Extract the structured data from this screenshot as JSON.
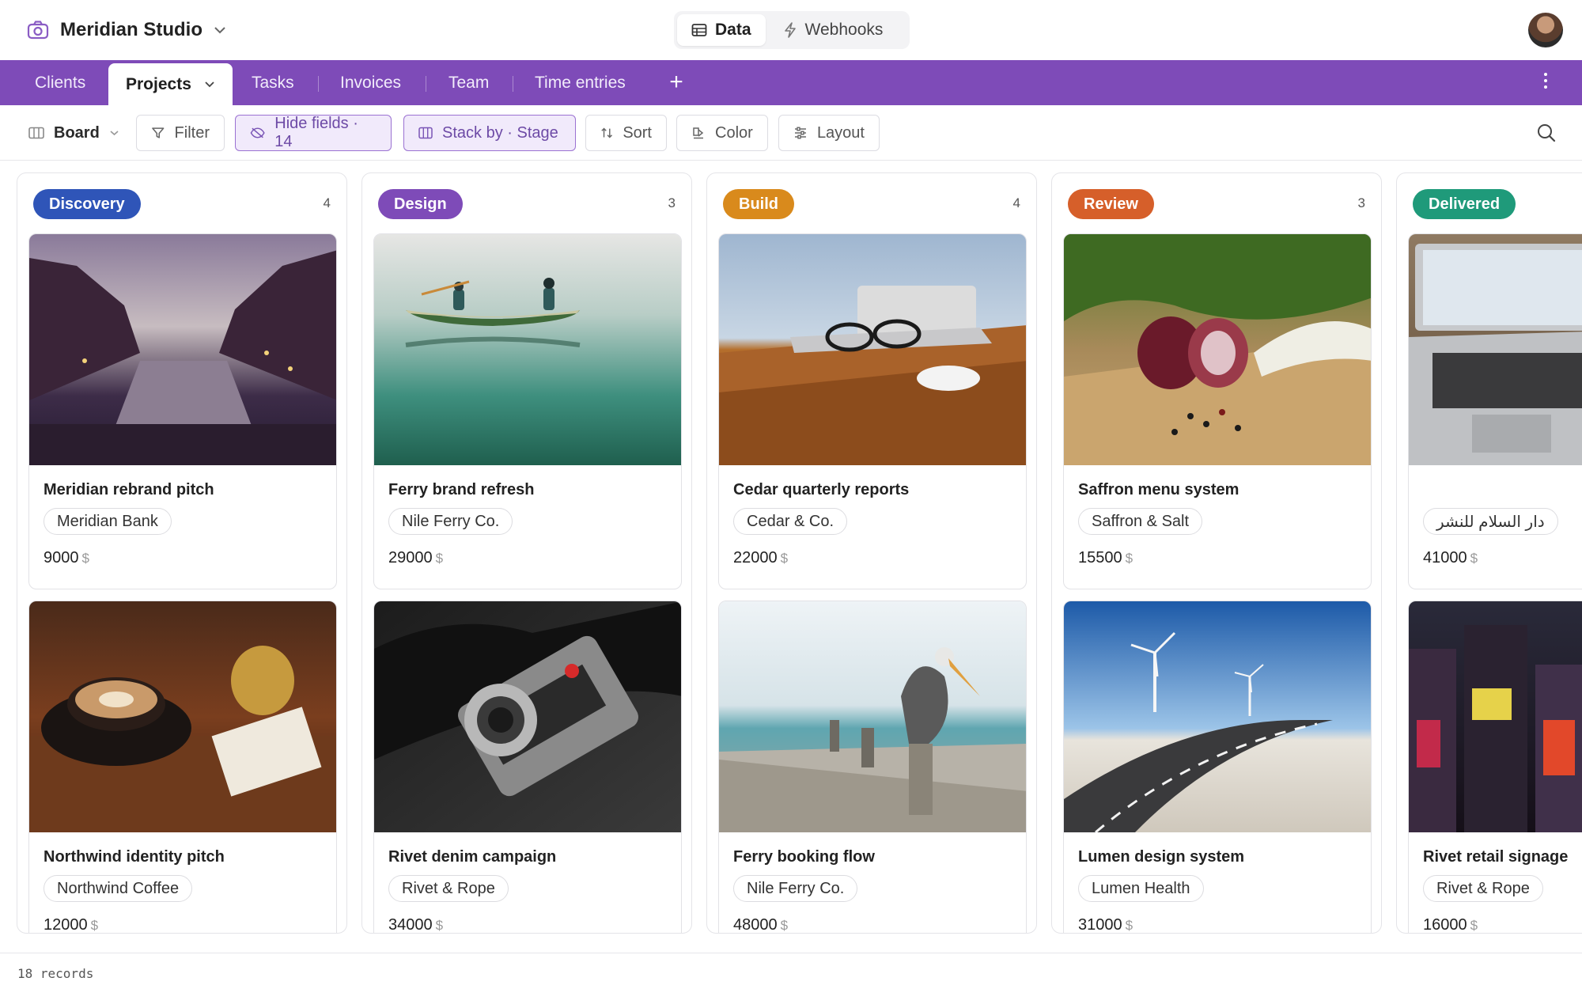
{
  "header": {
    "workspace": "Meridian Studio",
    "toggle": [
      {
        "label": "Data",
        "active": true
      },
      {
        "label": "Webhooks",
        "active": false
      }
    ]
  },
  "tabs": [
    {
      "label": "Clients"
    },
    {
      "label": "Projects",
      "active": true
    },
    {
      "label": "Tasks"
    },
    {
      "label": "Invoices"
    },
    {
      "label": "Team"
    },
    {
      "label": "Time entries"
    }
  ],
  "toolbar": {
    "view": "Board",
    "filter": "Filter",
    "hide_fields": "Hide fields · 14",
    "stack_by": "Stack by · Stage",
    "sort": "Sort",
    "color": "Color",
    "layout": "Layout"
  },
  "columns": [
    {
      "stage": "Discovery",
      "count": "4",
      "color": "#2f55b8",
      "cards": [
        {
          "title": "Meridian rebrand pitch",
          "client": "Meridian Bank",
          "amount": "9000",
          "currency": "$",
          "image": "canal-dusk"
        },
        {
          "title": "Northwind identity pitch",
          "client": "Northwind Coffee",
          "amount": "12000",
          "currency": "$",
          "image": "latte-cup"
        }
      ]
    },
    {
      "stage": "Design",
      "count": "3",
      "color": "#7e4bb8",
      "cards": [
        {
          "title": "Ferry brand refresh",
          "client": "Nile Ferry Co.",
          "amount": "29000",
          "currency": "$",
          "image": "canoe-lake"
        },
        {
          "title": "Rivet denim campaign",
          "client": "Rivet & Rope",
          "amount": "34000",
          "currency": "$",
          "image": "vintage-camera"
        }
      ]
    },
    {
      "stage": "Build",
      "count": "4",
      "color": "#d98a1c",
      "cards": [
        {
          "title": "Cedar quarterly reports",
          "client": "Cedar & Co.",
          "amount": "22000",
          "currency": "$",
          "image": "glasses-laptop"
        },
        {
          "title": "Ferry booking flow",
          "client": "Nile Ferry Co.",
          "amount": "48000",
          "currency": "$",
          "image": "pelican-pier"
        }
      ]
    },
    {
      "stage": "Review",
      "count": "3",
      "color": "#d65f2a",
      "cards": [
        {
          "title": "Saffron menu system",
          "client": "Saffron & Salt",
          "amount": "15500",
          "currency": "$",
          "image": "onion-pepper"
        },
        {
          "title": "Lumen design system",
          "client": "Lumen Health",
          "amount": "31000",
          "currency": "$",
          "image": "wind-road"
        }
      ]
    },
    {
      "stage": "Delivered",
      "count": "",
      "color": "#1f9a7a",
      "cards": [
        {
          "title": "",
          "client": "دار السلام للنشر",
          "amount": "41000",
          "currency": "$",
          "image": "laptop-desk"
        },
        {
          "title": "Rivet retail signage",
          "client": "Rivet & Rope",
          "amount": "16000",
          "currency": "$",
          "image": "city-night"
        }
      ]
    }
  ],
  "footer": {
    "records": "18 records"
  }
}
